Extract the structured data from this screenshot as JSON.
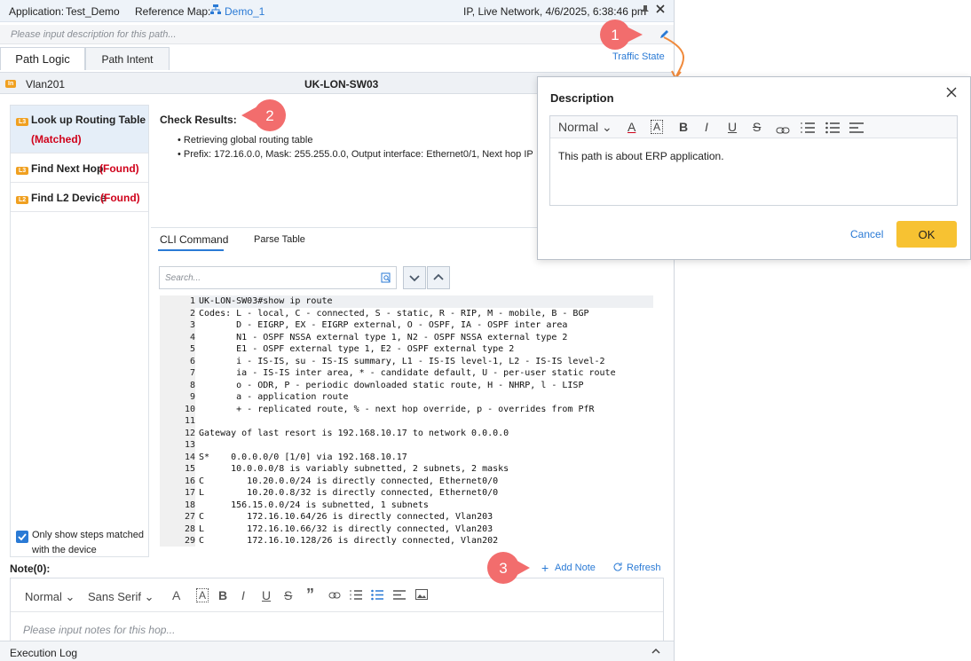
{
  "topbar": {
    "application_label": "Application:",
    "application_value": "Test_Demo",
    "reference_map_label": "Reference Map:",
    "reference_map_value": "Demo_1",
    "status": "IP, Live Network, 4/6/2025, 6:38:46 pm"
  },
  "description_bar": {
    "placeholder": "Please input description for this path..."
  },
  "tabs": [
    {
      "label": "Path Logic"
    },
    {
      "label": "Path Intent"
    }
  ],
  "traffic_state": "Traffic State",
  "hop": {
    "badge": "In",
    "interface": "Vlan201",
    "device": "UK-LON-SW03"
  },
  "steps": [
    {
      "badge": "L3",
      "label": "Look up Routing Table",
      "status": "(Matched)"
    },
    {
      "badge": "L3",
      "label": "Find Next Hop",
      "status": "(Found)"
    },
    {
      "badge": "L2",
      "label": "Find L2 Device",
      "status": "(Found)"
    }
  ],
  "filter": {
    "label": "Only show steps matched with the device",
    "checked": true
  },
  "check_results": {
    "title": "Check Results:",
    "items": [
      "Retrieving global routing table",
      "Prefix: 172.16.0.0, Mask: 255.255.0.0, Output interface: Ethernet0/1, Next hop IP"
    ]
  },
  "cli_tabs": [
    {
      "label": "CLI Command"
    },
    {
      "label": "Parse Table"
    }
  ],
  "search": {
    "placeholder": "Search..."
  },
  "code_lines": [
    {
      "n": "1",
      "t": "UK-LON-SW03#show ip route"
    },
    {
      "n": "2",
      "t": "Codes: L - local, C - connected, S - static, R - RIP, M - mobile, B - BGP"
    },
    {
      "n": "3",
      "t": "       D - EIGRP, EX - EIGRP external, O - OSPF, IA - OSPF inter area"
    },
    {
      "n": "4",
      "t": "       N1 - OSPF NSSA external type 1, N2 - OSPF NSSA external type 2"
    },
    {
      "n": "5",
      "t": "       E1 - OSPF external type 1, E2 - OSPF external type 2"
    },
    {
      "n": "6",
      "t": "       i - IS-IS, su - IS-IS summary, L1 - IS-IS level-1, L2 - IS-IS level-2"
    },
    {
      "n": "7",
      "t": "       ia - IS-IS inter area, * - candidate default, U - per-user static route"
    },
    {
      "n": "8",
      "t": "       o - ODR, P - periodic downloaded static route, H - NHRP, l - LISP"
    },
    {
      "n": "9",
      "t": "       a - application route"
    },
    {
      "n": "10",
      "t": "       + - replicated route, % - next hop override, p - overrides from PfR"
    },
    {
      "n": "11",
      "t": ""
    },
    {
      "n": "12",
      "t": "Gateway of last resort is 192.168.10.17 to network 0.0.0.0"
    },
    {
      "n": "13",
      "t": ""
    },
    {
      "n": "14",
      "t": "S*    0.0.0.0/0 [1/0] via 192.168.10.17"
    },
    {
      "n": "15",
      "t": "      10.0.0.0/8 is variably subnetted, 2 subnets, 2 masks"
    },
    {
      "n": "16",
      "t": "C        10.20.0.0/24 is directly connected, Ethernet0/0"
    },
    {
      "n": "17",
      "t": "L        10.20.0.8/32 is directly connected, Ethernet0/0"
    },
    {
      "n": "18",
      "t": "      156.15.0.0/24 is subnetted, 1 subnets"
    },
    {
      "n": "27",
      "t": "C        172.16.10.64/26 is directly connected, Vlan203"
    },
    {
      "n": "28",
      "t": "L        172.16.10.66/32 is directly connected, Vlan203"
    },
    {
      "n": "29",
      "t": "C        172.16.10.128/26 is directly connected, Vlan202"
    }
  ],
  "notes": {
    "title": "Note(0):",
    "add_note": "Add Note",
    "refresh": "Refresh",
    "format": "Normal",
    "font": "Sans Serif",
    "placeholder": "Please input notes for this hop..."
  },
  "execution_log": "Execution Log",
  "dialog": {
    "title": "Description",
    "format": "Normal",
    "content": "This path is about ERP application.",
    "cancel": "Cancel",
    "ok": "OK"
  },
  "callouts": [
    "1",
    "2",
    "3"
  ],
  "colors": {
    "accent": "#2a7ad5",
    "ok_button": "#f7c232",
    "callout": "#f26d6d",
    "status_red": "#d0021b",
    "connector": "#f08a3c"
  }
}
